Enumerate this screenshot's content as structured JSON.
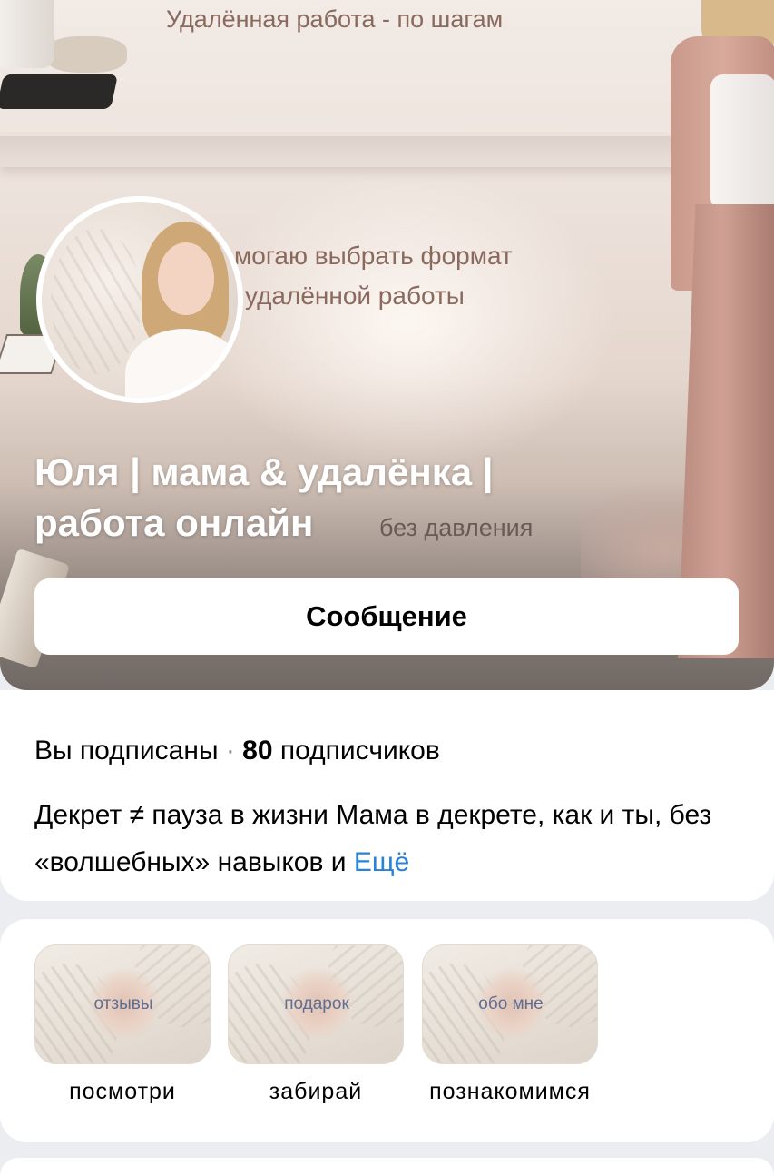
{
  "cover": {
    "top_text": "Удалённая работа -  по шагам",
    "mid_text_line1": "могаю выбрать формат",
    "mid_text_line2": "удалённой работы",
    "low_text": "без давления"
  },
  "profile": {
    "name": "Юля | мама & удалёнка | работа онлайн",
    "message_button": "Сообщение"
  },
  "info": {
    "subscribed_text": "Вы подписаны",
    "separator": " · ",
    "subscribers_count": "80",
    "subscribers_label": " подписчиков",
    "description": "Декрет ≠ пауза в жизни Мама в декрете, как и ты, без «волшебных» навыков и ",
    "more_link": "Ещё"
  },
  "stories": [
    {
      "thumb_label": "отзывы",
      "caption": "посмотри"
    },
    {
      "thumb_label": "подарок",
      "caption": "забирай"
    },
    {
      "thumb_label": "обо мне",
      "caption": "познакомимся"
    }
  ]
}
